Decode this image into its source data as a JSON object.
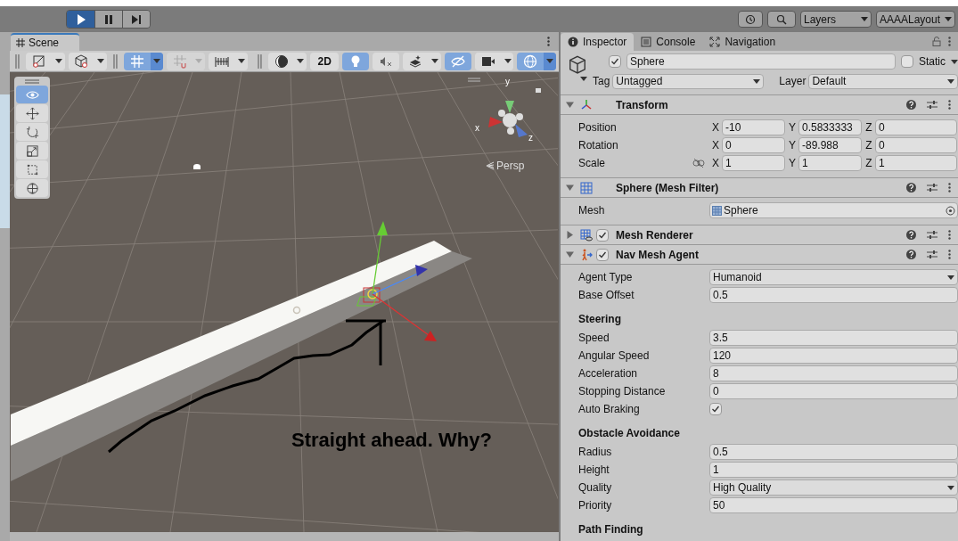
{
  "toolbar": {
    "play_controls": [
      {
        "kind": "play",
        "selected": true
      },
      {
        "kind": "pause",
        "selected": false
      },
      {
        "kind": "step",
        "selected": false
      }
    ],
    "right": [
      {
        "kind": "history"
      },
      {
        "kind": "search"
      },
      {
        "kind": "dropdown",
        "label": "Layers"
      },
      {
        "kind": "dropdown",
        "label": "AAAALayout"
      }
    ]
  },
  "scene": {
    "tab": "Scene",
    "toolbar_left": [
      {
        "kind": "grip"
      },
      {
        "kind": "tool",
        "selected": false,
        "disabled": false,
        "caret": true
      },
      {
        "kind": "tool",
        "selected": false,
        "disabled": false,
        "caret": true
      },
      {
        "kind": "grip"
      },
      {
        "kind": "tool",
        "selected": true,
        "disabled": false,
        "caret": true
      },
      {
        "kind": "tool",
        "selected": false,
        "disabled": true,
        "caret": true
      },
      {
        "kind": "tool",
        "selected": false,
        "disabled": false,
        "caret": true
      }
    ],
    "toolbar_right": [
      {
        "kind": "grip"
      },
      {
        "kind": "tool",
        "selected": false,
        "disabled": false,
        "caret": true
      },
      {
        "kind": "text",
        "label": "2D",
        "selected": false
      },
      {
        "kind": "tool",
        "selected": true,
        "disabled": false,
        "caret": false
      },
      {
        "kind": "tool",
        "selected": false,
        "disabled": false,
        "caret": false
      },
      {
        "kind": "tool",
        "selected": false,
        "disabled": false,
        "caret": true
      },
      {
        "kind": "tool",
        "selected": true,
        "disabled": false,
        "caret": false
      },
      {
        "kind": "tool",
        "selected": false,
        "disabled": false,
        "caret": true
      },
      {
        "kind": "tool",
        "selected": true,
        "disabled": false,
        "caret": true
      }
    ],
    "tools": [
      {
        "selected": true
      },
      {
        "selected": false
      },
      {
        "selected": false
      },
      {
        "selected": false
      },
      {
        "selected": false
      },
      {
        "selected": false
      }
    ],
    "axes": [
      "y",
      "x",
      "z"
    ],
    "projection": "Persp",
    "annotation": "Straight ahead. Why?"
  },
  "inspector": {
    "tabs": [
      {
        "label": "Inspector",
        "selected": true
      },
      {
        "label": "Console",
        "selected": false
      },
      {
        "label": "Navigation",
        "selected": false
      }
    ],
    "object": {
      "enabled": true,
      "name": "Sphere",
      "static": false,
      "static_label": "Static",
      "tag_label": "Tag",
      "tag": "Untagged",
      "layer_label": "Layer",
      "layer": "Default"
    },
    "components": [
      {
        "kind": "transform",
        "title": "Transform",
        "expanded": true,
        "rows": [
          {
            "kind": "vector",
            "label": "Position",
            "proportional_toggle": false,
            "values": [
              {
                "axis": "X",
                "value": "-10"
              },
              {
                "axis": "Y",
                "value": "0.5833333"
              },
              {
                "axis": "Z",
                "value": "0"
              }
            ]
          },
          {
            "kind": "vector",
            "label": "Rotation",
            "proportional_toggle": false,
            "values": [
              {
                "axis": "X",
                "value": "0"
              },
              {
                "axis": "Y",
                "value": "-89.988"
              },
              {
                "axis": "Z",
                "value": "0"
              }
            ]
          },
          {
            "kind": "vector",
            "label": "Scale",
            "proportional_toggle": true,
            "values": [
              {
                "axis": "X",
                "value": "1"
              },
              {
                "axis": "Y",
                "value": "1"
              },
              {
                "axis": "Z",
                "value": "1"
              }
            ]
          }
        ]
      },
      {
        "kind": "mesh-filter",
        "title": "Sphere (Mesh Filter)",
        "expanded": true,
        "rows": [
          {
            "kind": "object",
            "label": "Mesh",
            "value": "Sphere"
          }
        ]
      },
      {
        "kind": "mesh-renderer",
        "title": "Mesh Renderer",
        "expanded": false,
        "enabled": true
      },
      {
        "kind": "nav-agent",
        "title": "Nav Mesh Agent",
        "expanded": true,
        "enabled": true,
        "rows": [
          {
            "kind": "dropdown",
            "label": "Agent Type",
            "value": "Humanoid"
          },
          {
            "kind": "field",
            "label": "Base Offset",
            "value": "0.5"
          },
          {
            "kind": "heading",
            "label": "Steering"
          },
          {
            "kind": "field",
            "label": "Speed",
            "value": "3.5"
          },
          {
            "kind": "field",
            "label": "Angular Speed",
            "value": "120"
          },
          {
            "kind": "field",
            "label": "Acceleration",
            "value": "8"
          },
          {
            "kind": "field",
            "label": "Stopping Distance",
            "value": "0"
          },
          {
            "kind": "checkbox",
            "label": "Auto Braking",
            "checked": true
          },
          {
            "kind": "heading",
            "label": "Obstacle Avoidance"
          },
          {
            "kind": "field",
            "label": "Radius",
            "value": "0.5"
          },
          {
            "kind": "field",
            "label": "Height",
            "value": "1"
          },
          {
            "kind": "dropdown",
            "label": "Quality",
            "value": "High Quality"
          },
          {
            "kind": "field",
            "label": "Priority",
            "value": "50"
          },
          {
            "kind": "heading",
            "label": "Path Finding"
          }
        ]
      }
    ]
  }
}
